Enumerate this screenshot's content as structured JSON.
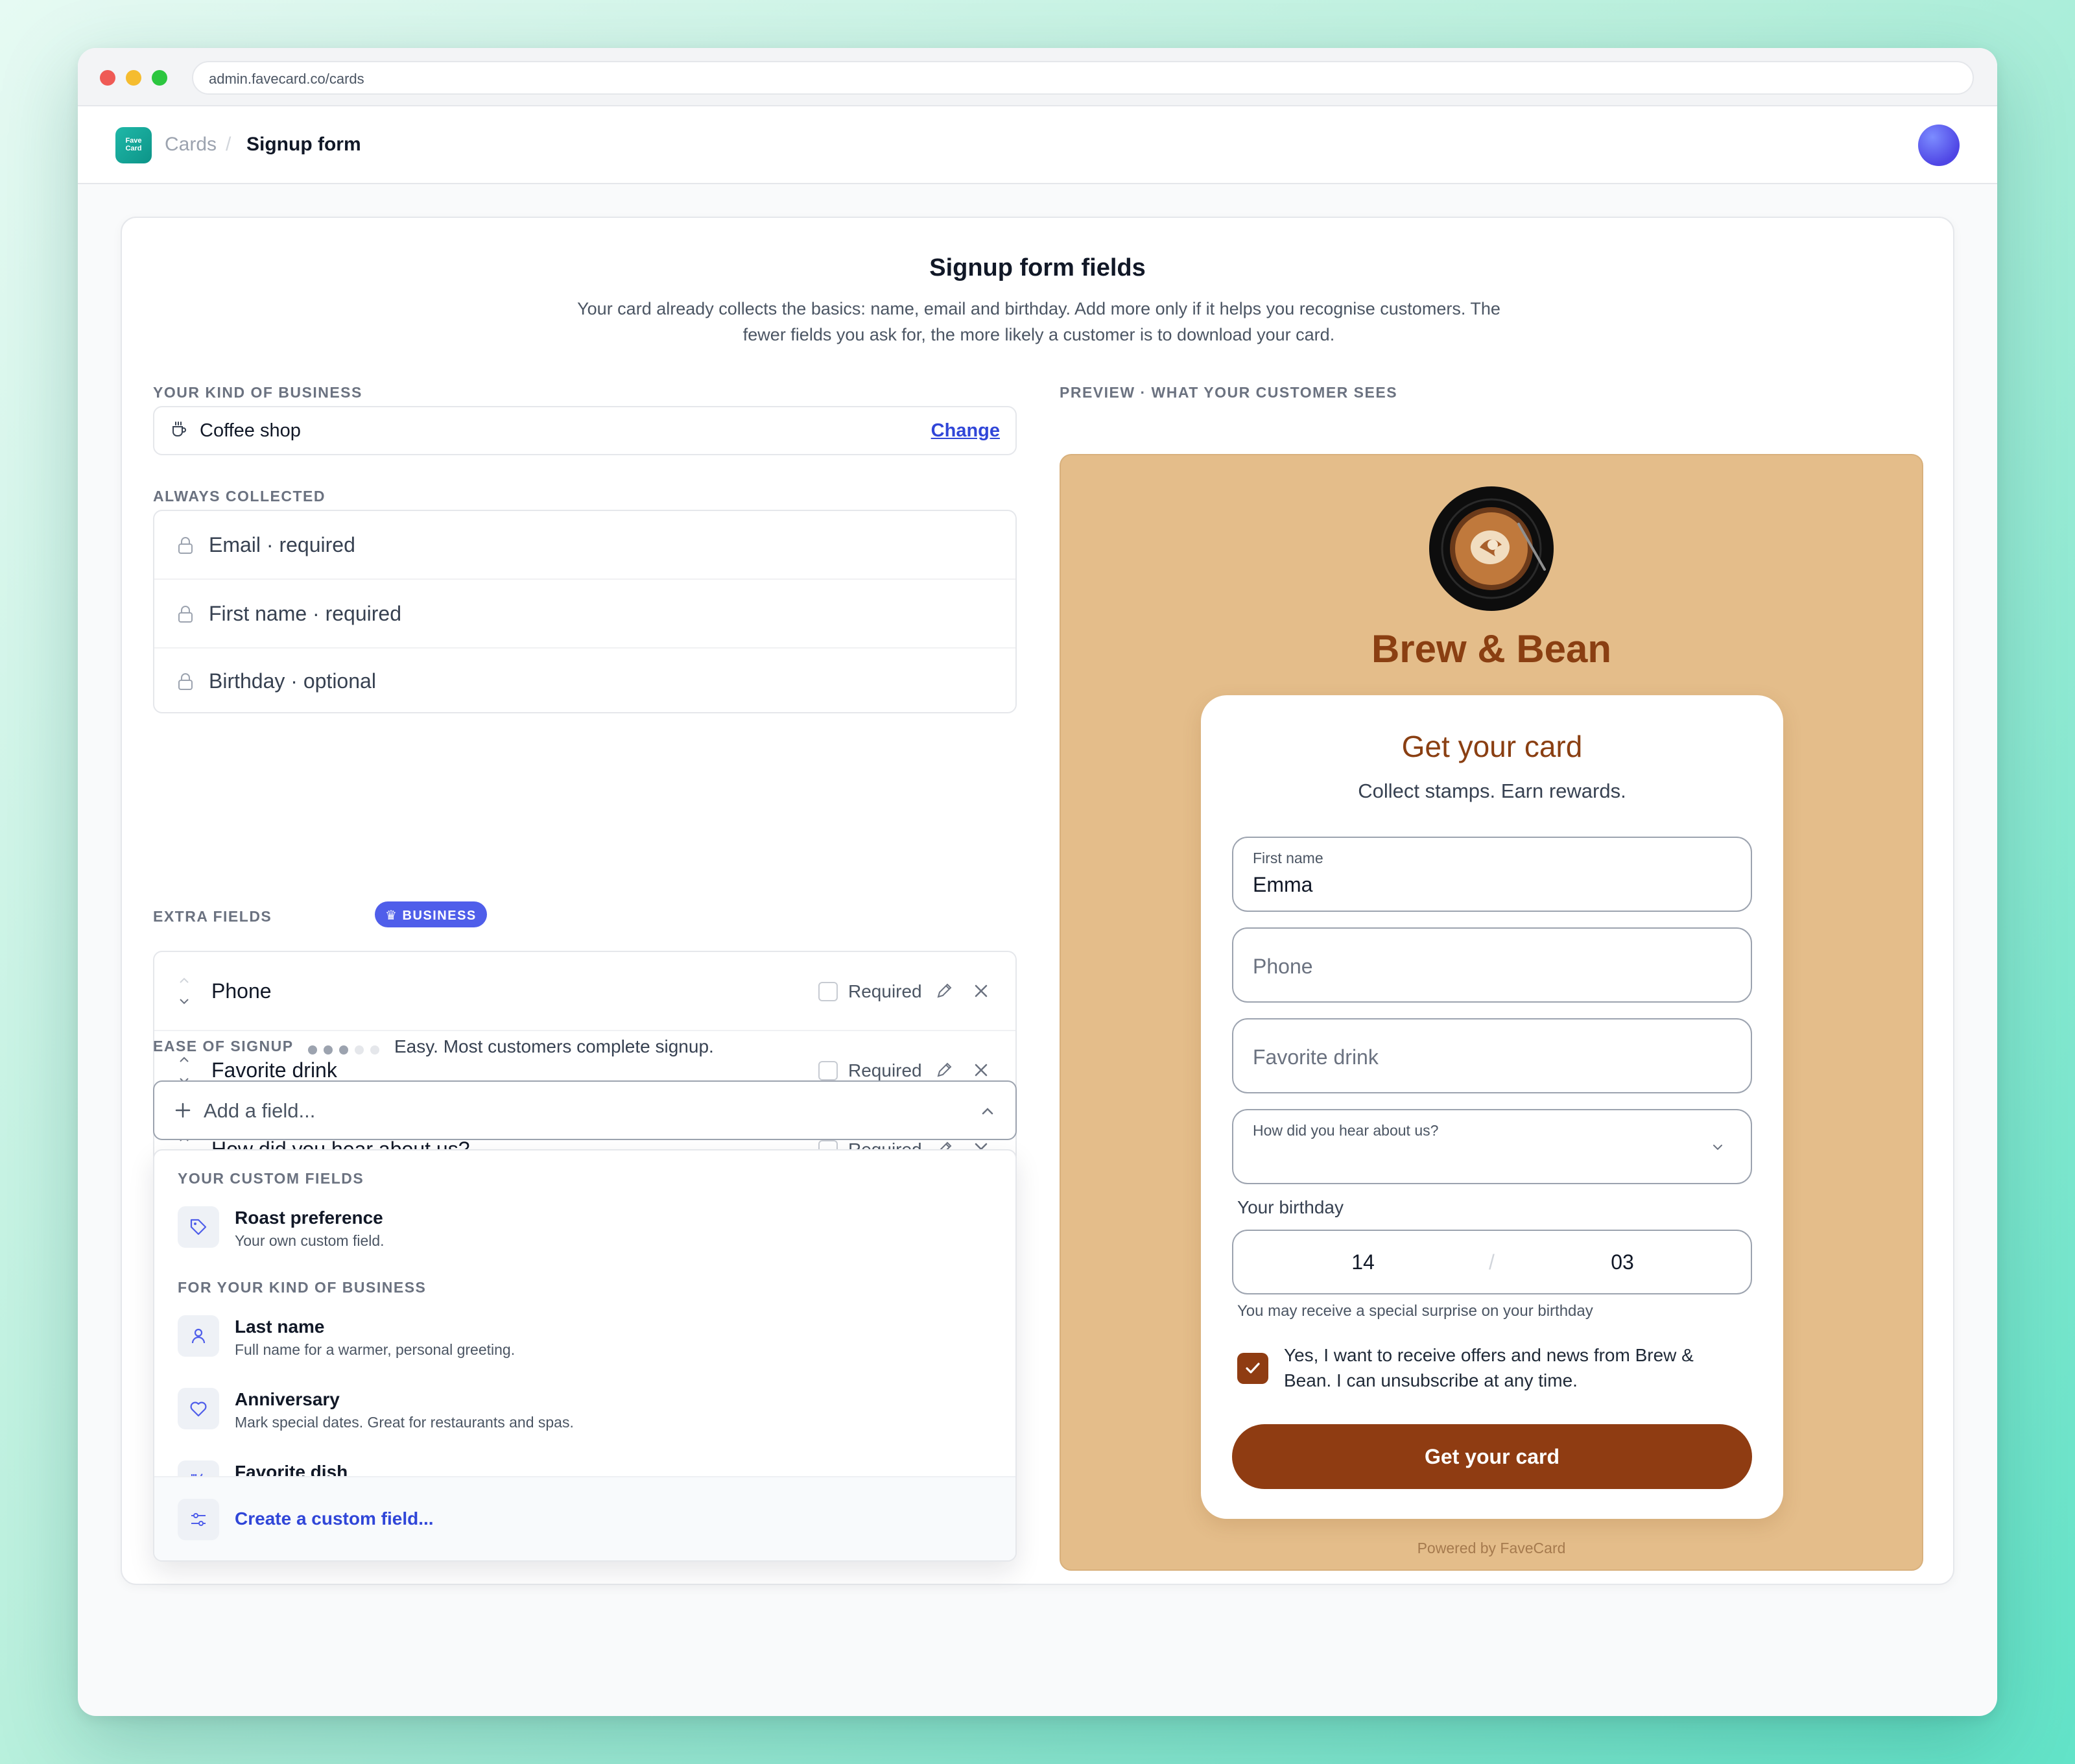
{
  "browser": {
    "url": "admin.favecard.co/cards"
  },
  "app": {
    "logo_text_line1": "Fave",
    "logo_text_line2": "Card",
    "breadcrumb": {
      "parent": "Cards",
      "separator": "/",
      "current": "Signup form"
    }
  },
  "panel": {
    "title": "Signup form fields",
    "subtitle": "Your card already collects the basics: name, email and birthday. Add more only if it helps you recognise customers. The fewer fields you ask for, the more likely a customer is to download your card."
  },
  "business": {
    "section_label": "YOUR KIND OF BUSINESS",
    "icon": "coffee-cup-icon",
    "value": "Coffee shop",
    "change_label": "Change"
  },
  "always_collected": {
    "section_label": "ALWAYS COLLECTED",
    "icon": "lock-icon",
    "items": [
      {
        "label": "Email · required"
      },
      {
        "label": "First name · required"
      },
      {
        "label": "Birthday · optional"
      }
    ]
  },
  "extra_fields": {
    "section_label": "EXTRA FIELDS",
    "badge": "BUSINESS",
    "required_label": "Required",
    "items": [
      {
        "label": "Phone",
        "required": false
      },
      {
        "label": "Favorite drink",
        "required": false
      },
      {
        "label": "How did you hear about us?",
        "required": false
      }
    ]
  },
  "ease": {
    "label": "EASE OF SIGNUP",
    "filled": 3,
    "total": 5,
    "text": "Easy. Most customers complete signup."
  },
  "add_field": {
    "placeholder": "Add a field...",
    "groups": [
      {
        "label": "YOUR CUSTOM FIELDS",
        "items": [
          {
            "title": "Roast preference",
            "desc": "Your own custom field.",
            "icon": "tag-icon"
          }
        ]
      },
      {
        "label": "FOR YOUR KIND OF BUSINESS",
        "items": [
          {
            "title": "Last name",
            "desc": "Full name for a warmer, personal greeting.",
            "icon": "person-icon"
          },
          {
            "title": "Anniversary",
            "desc": "Mark special dates. Great for restaurants and spas.",
            "icon": "heart-icon"
          },
          {
            "title": "Favorite dish",
            "desc": "",
            "icon": "utensils-icon"
          }
        ]
      }
    ],
    "footer": {
      "label": "Create a custom field...",
      "icon": "sliders-icon"
    }
  },
  "preview": {
    "section_label": "PREVIEW · WHAT YOUR CUSTOMER SEES",
    "brand": "Brew & Bean",
    "colors": {
      "background": "#e4bd8a",
      "brand": "#8a3f12",
      "button": "#8f3c12"
    },
    "card_title": "Get your card",
    "card_subtitle": "Collect stamps. Earn rewards.",
    "first_name": {
      "label": "First name",
      "value": "Emma"
    },
    "phone_placeholder": "Phone",
    "drink_placeholder": "Favorite drink",
    "hear_label": "How did you hear about us?",
    "birthday": {
      "label": "Your birthday",
      "day": "14",
      "separator": "/",
      "month": "03",
      "hint": "You may receive a special surprise on your birthday"
    },
    "consent": {
      "checked": true,
      "text": "Yes, I want to receive offers and news from Brew & Bean. I can unsubscribe at any time."
    },
    "cta": "Get your card",
    "powered_by": "Powered by FaveCard"
  }
}
